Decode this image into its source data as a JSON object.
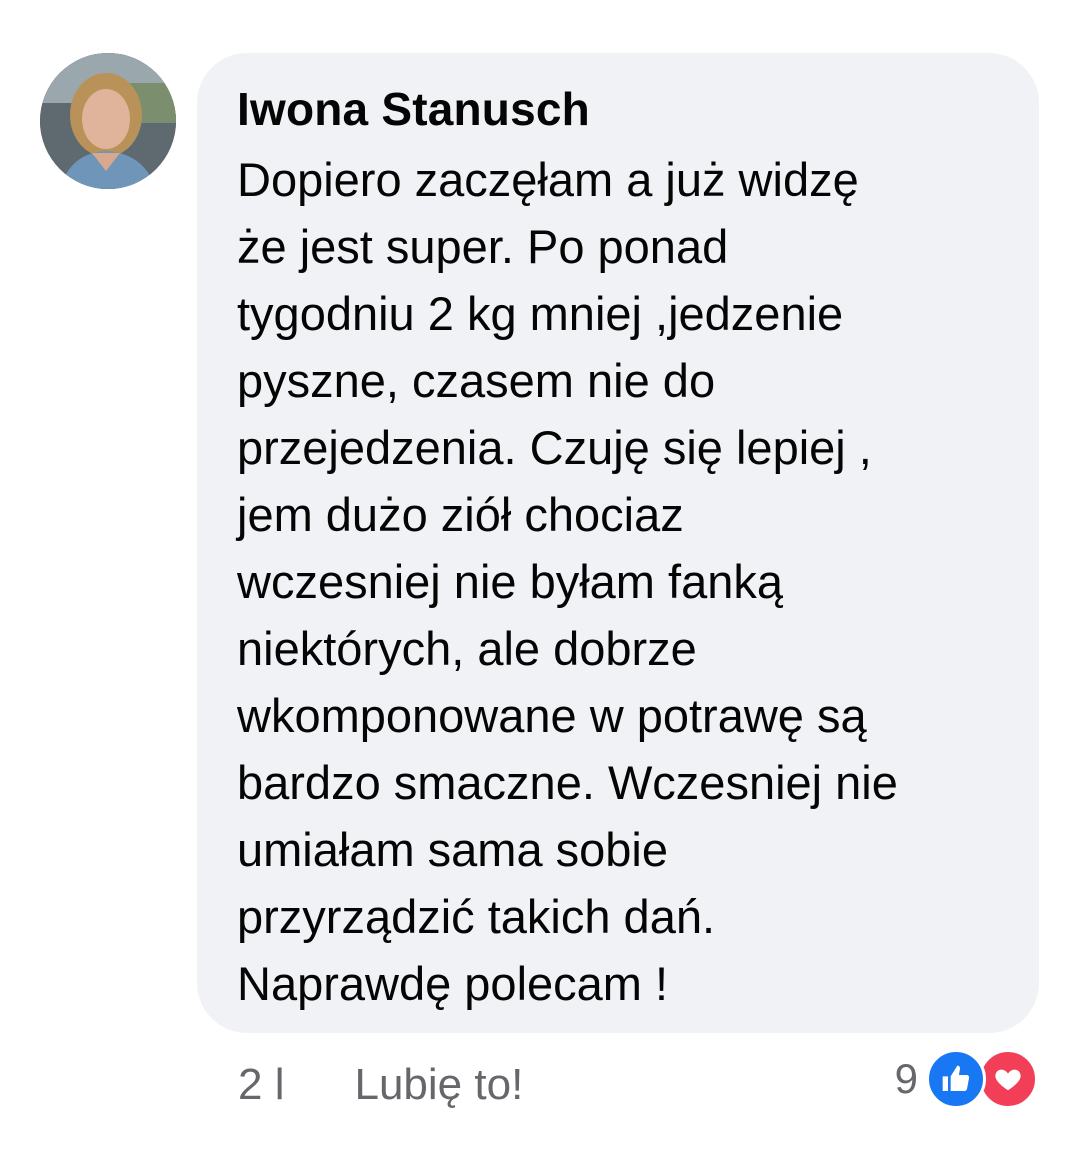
{
  "comment": {
    "author": "Iwona Stanusch",
    "lines": [
      "Dopiero zaczęłam a już widzę",
      "że jest super. Po ponad",
      "tygodniu 2 kg mniej ,jedzenie",
      "pyszne, czasem nie do",
      "przejedzenia. Czuję się lepiej ,",
      "jem dużo ziół chociaz",
      "wczesniej nie byłam fanką",
      "niektórych, ale dobrze",
      "wkomponowane w potrawę są",
      "bardzo smaczne. Wczesniej nie",
      "umiałam sama sobie",
      "przyrządzić takich dań.",
      "Naprawdę polecam !"
    ]
  },
  "actions": {
    "time": "2 l",
    "like_label": "Lubię to!"
  },
  "reactions": {
    "count": "9",
    "icons": [
      "like-reaction-icon",
      "love-reaction-icon"
    ],
    "colors": {
      "like": "#1877f2",
      "love": "#f33e58"
    }
  }
}
